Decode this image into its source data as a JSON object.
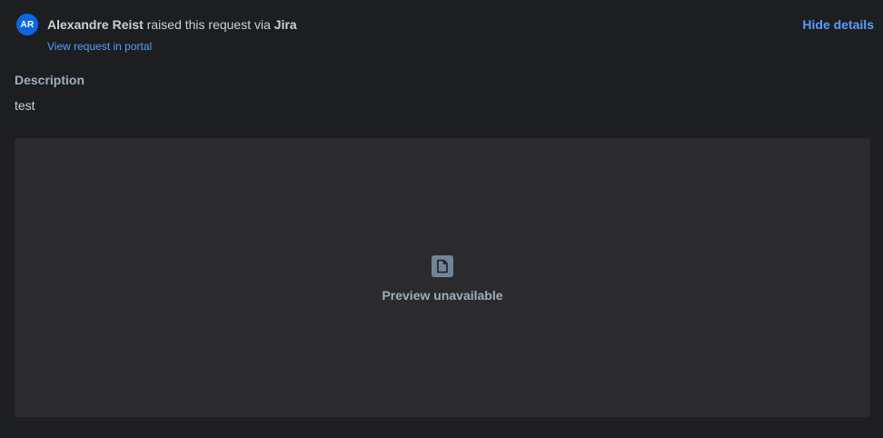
{
  "requester": {
    "initials": "AR",
    "name": "Alexandre Reist",
    "raised_text": " raised this request via ",
    "channel": "Jira",
    "portal_link": "View request in portal"
  },
  "actions": {
    "hide_details": "Hide details"
  },
  "description": {
    "heading": "Description",
    "text": "test"
  },
  "attachment": {
    "icon": "file-icon",
    "preview_label": "Preview unavailable"
  },
  "colors": {
    "background": "#1d1e20",
    "panel": "#2b2b2d",
    "link": "#579dff",
    "avatar": "#0c66e4"
  }
}
